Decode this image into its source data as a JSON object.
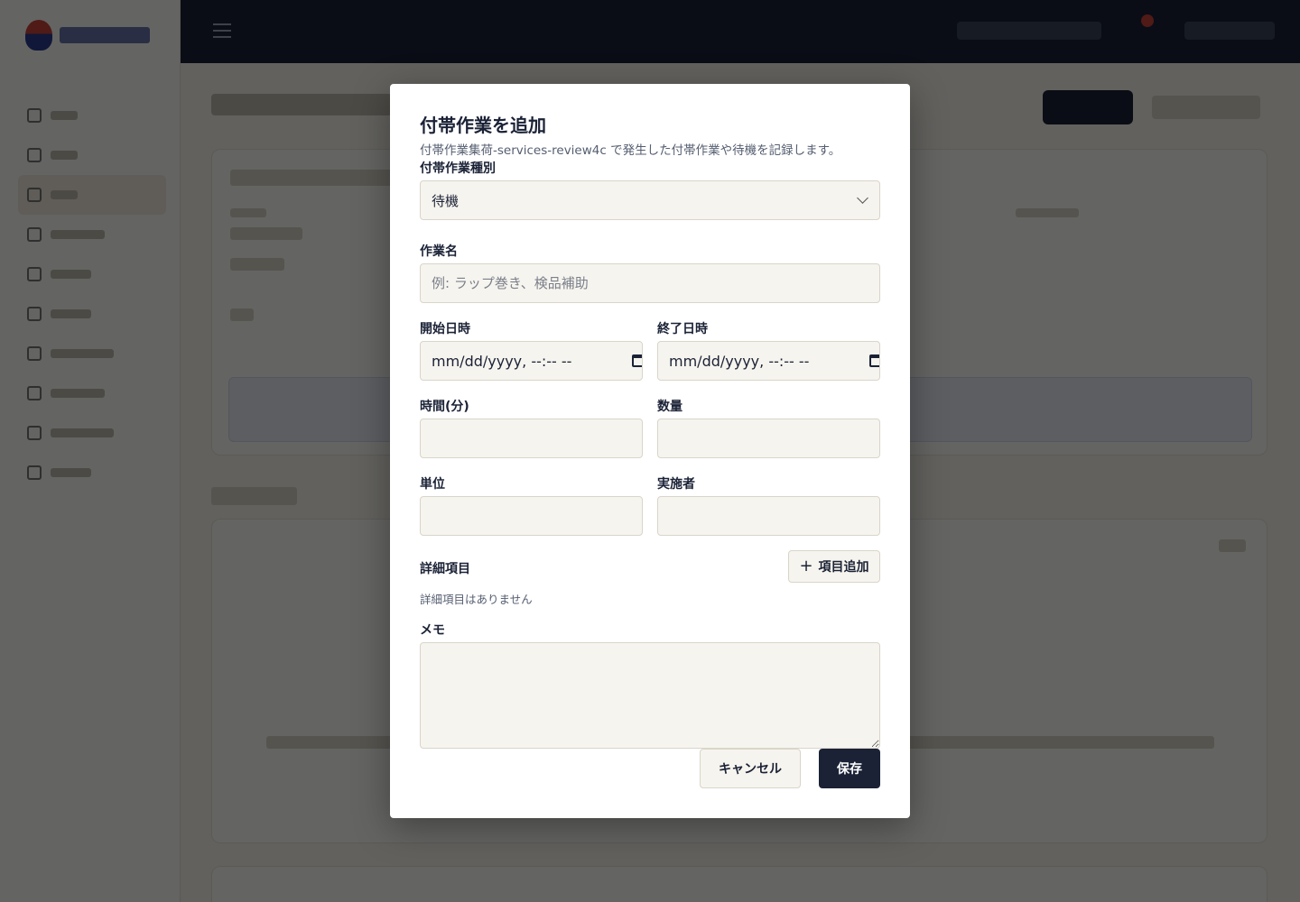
{
  "modal": {
    "title": "付帯作業を追加",
    "description": "付帯作業集荷-services-review4c で発生した付帯作業や待機を記録します。",
    "fields": {
      "work_type": {
        "label": "付帯作業種別",
        "value": "待機"
      },
      "work_name": {
        "label": "作業名",
        "placeholder": "例: ラップ巻き、検品補助"
      },
      "start_datetime": {
        "label": "開始日時",
        "placeholder": "mm/dd/yyyy, --:-- --"
      },
      "end_datetime": {
        "label": "終了日時",
        "placeholder": "mm/dd/yyyy, --:-- --"
      },
      "duration_minutes": {
        "label": "時間(分)"
      },
      "quantity": {
        "label": "数量"
      },
      "unit": {
        "label": "単位"
      },
      "performer": {
        "label": "実施者"
      },
      "detail_items": {
        "label": "詳細項目",
        "add_button": "項目追加",
        "empty_text": "詳細項目はありません"
      },
      "memo": {
        "label": "メモ"
      }
    },
    "buttons": {
      "cancel": "キャンセル",
      "save": "保存"
    }
  },
  "icons": {
    "select_chevron": "chevron-down-icon",
    "add": "plus-icon",
    "calendar": "calendar-icon"
  },
  "colors": {
    "primary": "#1b2236",
    "field_bg": "#f6f4ee",
    "overlay": "rgba(0,0,0,0.6)",
    "notification": "#c8413a"
  }
}
